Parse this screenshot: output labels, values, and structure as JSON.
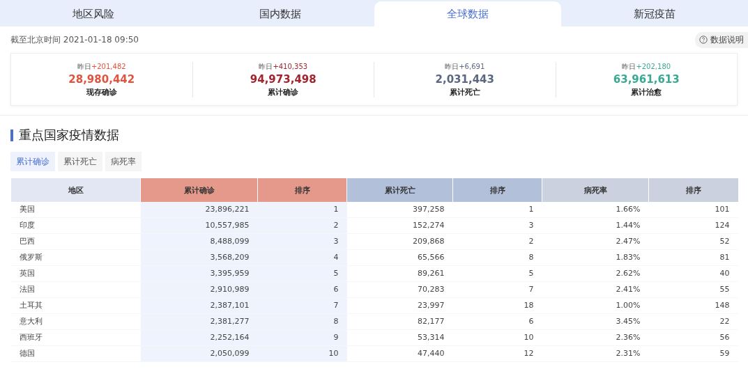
{
  "tabs": [
    {
      "label": "地区风险",
      "selected": false
    },
    {
      "label": "国内数据",
      "selected": false
    },
    {
      "label": "全球数据",
      "selected": true
    },
    {
      "label": "新冠疫苗",
      "selected": false
    }
  ],
  "update_time": "截至北京时间 2021-01-18 09:50",
  "help_link": "数据说明",
  "stats": [
    {
      "delta_label": "昨日",
      "delta": "+201,482",
      "value": "28,980,442",
      "label": "现存确诊",
      "color": "#e0533e"
    },
    {
      "delta_label": "昨日",
      "delta": "+410,353",
      "value": "94,973,498",
      "label": "累计确诊",
      "color": "#a3232f"
    },
    {
      "delta_label": "昨日",
      "delta": "+6,691",
      "value": "2,031,443",
      "label": "累计死亡",
      "color": "#5b6680"
    },
    {
      "delta_label": "昨日",
      "delta": "+202,180",
      "value": "63,961,613",
      "label": "累计治愈",
      "color": "#3aa994"
    }
  ],
  "section_title": "重点国家疫情数据",
  "sub_tabs": [
    {
      "label": "累计确诊",
      "selected": true
    },
    {
      "label": "累计死亡",
      "selected": false
    },
    {
      "label": "病死率",
      "selected": false
    }
  ],
  "table": {
    "columns": [
      {
        "label": "地区",
        "color": "#e2e7f3",
        "highlighted": false
      },
      {
        "label": "累计确诊",
        "color": "#e5998b",
        "highlighted": true
      },
      {
        "label": "排序",
        "color": "#e5998b",
        "highlighted": true
      },
      {
        "label": "累计死亡",
        "color": "#b3c0da",
        "highlighted": false
      },
      {
        "label": "排序",
        "color": "#b3c0da",
        "highlighted": false
      },
      {
        "label": "病死率",
        "color": "#ccd1df",
        "highlighted": false
      },
      {
        "label": "排序",
        "color": "#ccd1df",
        "highlighted": false
      }
    ],
    "rows": [
      [
        "美国",
        "23,896,221",
        "1",
        "397,258",
        "1",
        "1.66%",
        "101"
      ],
      [
        "印度",
        "10,557,985",
        "2",
        "152,274",
        "3",
        "1.44%",
        "124"
      ],
      [
        "巴西",
        "8,488,099",
        "3",
        "209,868",
        "2",
        "2.47%",
        "52"
      ],
      [
        "俄罗斯",
        "3,568,209",
        "4",
        "65,566",
        "8",
        "1.83%",
        "81"
      ],
      [
        "英国",
        "3,395,959",
        "5",
        "89,261",
        "5",
        "2.62%",
        "40"
      ],
      [
        "法国",
        "2,910,989",
        "6",
        "70,283",
        "7",
        "2.41%",
        "55"
      ],
      [
        "土耳其",
        "2,387,101",
        "7",
        "23,997",
        "18",
        "1.00%",
        "148"
      ],
      [
        "意大利",
        "2,381,277",
        "8",
        "82,177",
        "6",
        "3.45%",
        "22"
      ],
      [
        "西班牙",
        "2,252,164",
        "9",
        "53,314",
        "10",
        "2.36%",
        "56"
      ],
      [
        "德国",
        "2,050,099",
        "10",
        "47,440",
        "12",
        "2.31%",
        "59"
      ]
    ]
  }
}
